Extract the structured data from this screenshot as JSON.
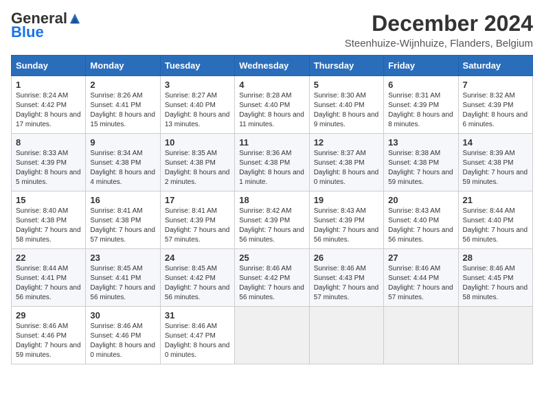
{
  "header": {
    "logo_general": "General",
    "logo_blue": "Blue",
    "month_title": "December 2024",
    "location": "Steenhuize-Wijnhuize, Flanders, Belgium"
  },
  "days_of_week": [
    "Sunday",
    "Monday",
    "Tuesday",
    "Wednesday",
    "Thursday",
    "Friday",
    "Saturday"
  ],
  "weeks": [
    [
      {
        "day": "1",
        "sunrise": "Sunrise: 8:24 AM",
        "sunset": "Sunset: 4:42 PM",
        "daylight": "Daylight: 8 hours and 17 minutes."
      },
      {
        "day": "2",
        "sunrise": "Sunrise: 8:26 AM",
        "sunset": "Sunset: 4:41 PM",
        "daylight": "Daylight: 8 hours and 15 minutes."
      },
      {
        "day": "3",
        "sunrise": "Sunrise: 8:27 AM",
        "sunset": "Sunset: 4:40 PM",
        "daylight": "Daylight: 8 hours and 13 minutes."
      },
      {
        "day": "4",
        "sunrise": "Sunrise: 8:28 AM",
        "sunset": "Sunset: 4:40 PM",
        "daylight": "Daylight: 8 hours and 11 minutes."
      },
      {
        "day": "5",
        "sunrise": "Sunrise: 8:30 AM",
        "sunset": "Sunset: 4:40 PM",
        "daylight": "Daylight: 8 hours and 9 minutes."
      },
      {
        "day": "6",
        "sunrise": "Sunrise: 8:31 AM",
        "sunset": "Sunset: 4:39 PM",
        "daylight": "Daylight: 8 hours and 8 minutes."
      },
      {
        "day": "7",
        "sunrise": "Sunrise: 8:32 AM",
        "sunset": "Sunset: 4:39 PM",
        "daylight": "Daylight: 8 hours and 6 minutes."
      }
    ],
    [
      {
        "day": "8",
        "sunrise": "Sunrise: 8:33 AM",
        "sunset": "Sunset: 4:39 PM",
        "daylight": "Daylight: 8 hours and 5 minutes."
      },
      {
        "day": "9",
        "sunrise": "Sunrise: 8:34 AM",
        "sunset": "Sunset: 4:38 PM",
        "daylight": "Daylight: 8 hours and 4 minutes."
      },
      {
        "day": "10",
        "sunrise": "Sunrise: 8:35 AM",
        "sunset": "Sunset: 4:38 PM",
        "daylight": "Daylight: 8 hours and 2 minutes."
      },
      {
        "day": "11",
        "sunrise": "Sunrise: 8:36 AM",
        "sunset": "Sunset: 4:38 PM",
        "daylight": "Daylight: 8 hours and 1 minute."
      },
      {
        "day": "12",
        "sunrise": "Sunrise: 8:37 AM",
        "sunset": "Sunset: 4:38 PM",
        "daylight": "Daylight: 8 hours and 0 minutes."
      },
      {
        "day": "13",
        "sunrise": "Sunrise: 8:38 AM",
        "sunset": "Sunset: 4:38 PM",
        "daylight": "Daylight: 7 hours and 59 minutes."
      },
      {
        "day": "14",
        "sunrise": "Sunrise: 8:39 AM",
        "sunset": "Sunset: 4:38 PM",
        "daylight": "Daylight: 7 hours and 59 minutes."
      }
    ],
    [
      {
        "day": "15",
        "sunrise": "Sunrise: 8:40 AM",
        "sunset": "Sunset: 4:38 PM",
        "daylight": "Daylight: 7 hours and 58 minutes."
      },
      {
        "day": "16",
        "sunrise": "Sunrise: 8:41 AM",
        "sunset": "Sunset: 4:38 PM",
        "daylight": "Daylight: 7 hours and 57 minutes."
      },
      {
        "day": "17",
        "sunrise": "Sunrise: 8:41 AM",
        "sunset": "Sunset: 4:39 PM",
        "daylight": "Daylight: 7 hours and 57 minutes."
      },
      {
        "day": "18",
        "sunrise": "Sunrise: 8:42 AM",
        "sunset": "Sunset: 4:39 PM",
        "daylight": "Daylight: 7 hours and 56 minutes."
      },
      {
        "day": "19",
        "sunrise": "Sunrise: 8:43 AM",
        "sunset": "Sunset: 4:39 PM",
        "daylight": "Daylight: 7 hours and 56 minutes."
      },
      {
        "day": "20",
        "sunrise": "Sunrise: 8:43 AM",
        "sunset": "Sunset: 4:40 PM",
        "daylight": "Daylight: 7 hours and 56 minutes."
      },
      {
        "day": "21",
        "sunrise": "Sunrise: 8:44 AM",
        "sunset": "Sunset: 4:40 PM",
        "daylight": "Daylight: 7 hours and 56 minutes."
      }
    ],
    [
      {
        "day": "22",
        "sunrise": "Sunrise: 8:44 AM",
        "sunset": "Sunset: 4:41 PM",
        "daylight": "Daylight: 7 hours and 56 minutes."
      },
      {
        "day": "23",
        "sunrise": "Sunrise: 8:45 AM",
        "sunset": "Sunset: 4:41 PM",
        "daylight": "Daylight: 7 hours and 56 minutes."
      },
      {
        "day": "24",
        "sunrise": "Sunrise: 8:45 AM",
        "sunset": "Sunset: 4:42 PM",
        "daylight": "Daylight: 7 hours and 56 minutes."
      },
      {
        "day": "25",
        "sunrise": "Sunrise: 8:46 AM",
        "sunset": "Sunset: 4:42 PM",
        "daylight": "Daylight: 7 hours and 56 minutes."
      },
      {
        "day": "26",
        "sunrise": "Sunrise: 8:46 AM",
        "sunset": "Sunset: 4:43 PM",
        "daylight": "Daylight: 7 hours and 57 minutes."
      },
      {
        "day": "27",
        "sunrise": "Sunrise: 8:46 AM",
        "sunset": "Sunset: 4:44 PM",
        "daylight": "Daylight: 7 hours and 57 minutes."
      },
      {
        "day": "28",
        "sunrise": "Sunrise: 8:46 AM",
        "sunset": "Sunset: 4:45 PM",
        "daylight": "Daylight: 7 hours and 58 minutes."
      }
    ],
    [
      {
        "day": "29",
        "sunrise": "Sunrise: 8:46 AM",
        "sunset": "Sunset: 4:46 PM",
        "daylight": "Daylight: 7 hours and 59 minutes."
      },
      {
        "day": "30",
        "sunrise": "Sunrise: 8:46 AM",
        "sunset": "Sunset: 4:46 PM",
        "daylight": "Daylight: 8 hours and 0 minutes."
      },
      {
        "day": "31",
        "sunrise": "Sunrise: 8:46 AM",
        "sunset": "Sunset: 4:47 PM",
        "daylight": "Daylight: 8 hours and 0 minutes."
      },
      null,
      null,
      null,
      null
    ]
  ]
}
